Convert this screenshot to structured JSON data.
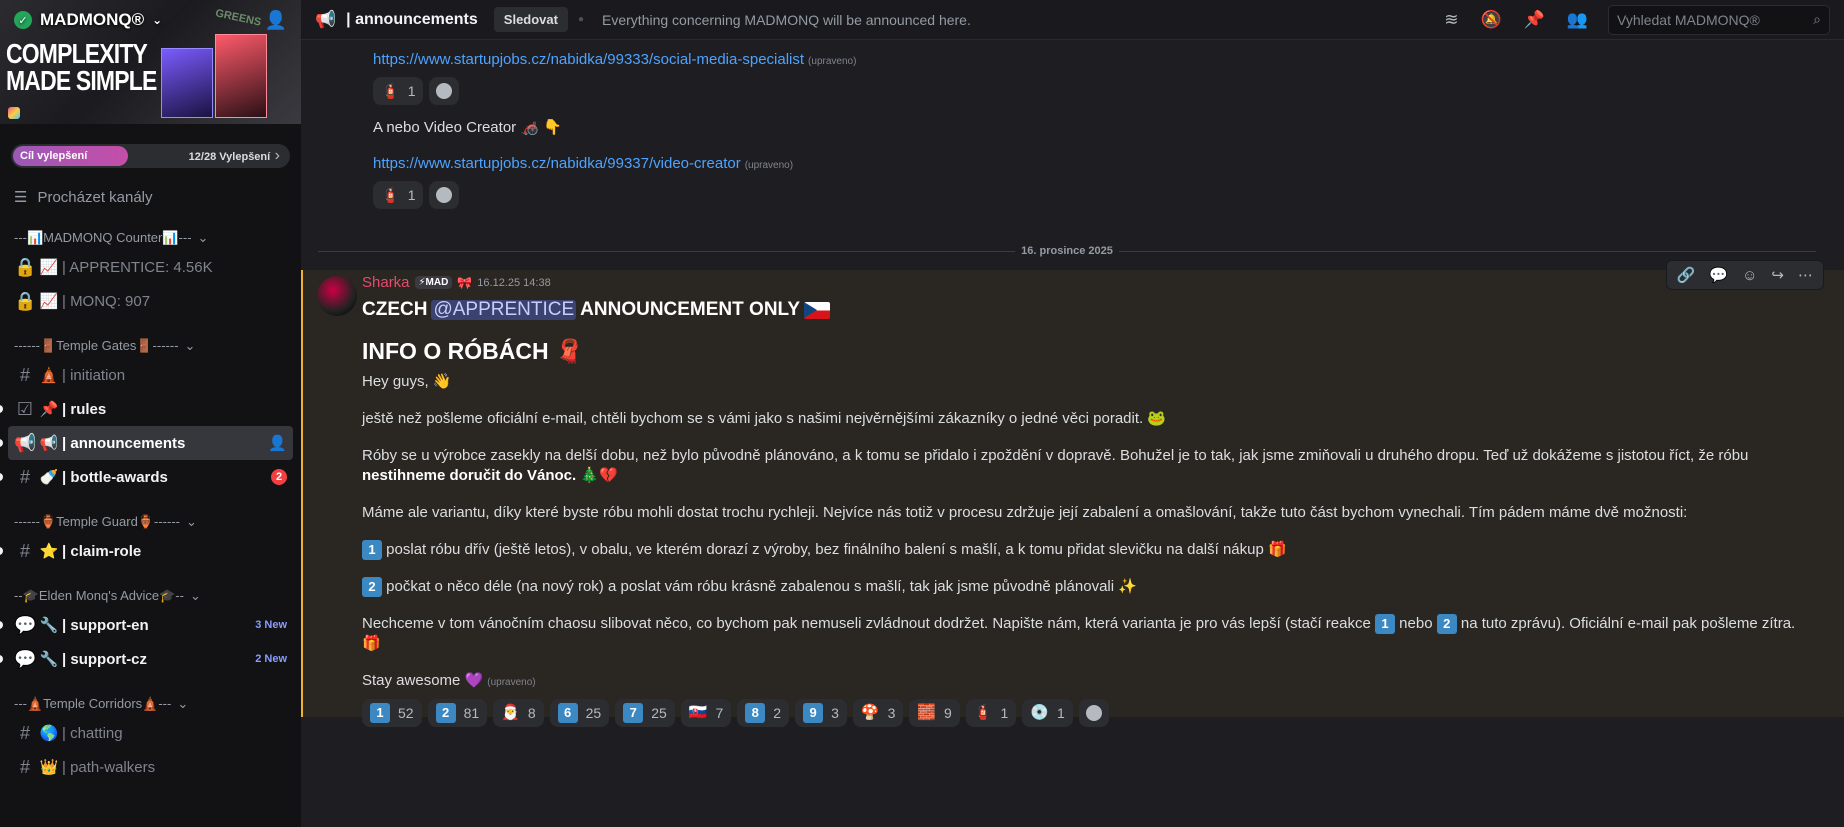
{
  "server": {
    "name": "MADMONQ®",
    "banner_headline_1": "COMPLEXITY",
    "banner_headline_2": "MADE SIMPLE",
    "banner_tag": "GREENS"
  },
  "boost": {
    "label": "Cíl vylepšení",
    "count": "12/28 Vylepšení",
    "progress": 0.43
  },
  "browse_label": "Procházet kanály",
  "sidebar": {
    "categories": [
      "---📊MADMONQ Counter📊---",
      "------🚪Temple Gates🚪------",
      "------🏺Temple Guard🏺------",
      "--🎓Elden Monq's Advice🎓--",
      "---🛕Temple Corridors🛕---"
    ],
    "channels": [
      {
        "icon": "📈",
        "label": "|  APPRENTICE: 4.56K"
      },
      {
        "icon": "📈",
        "label": "|  MONQ: 907"
      },
      {
        "icon": "🛕",
        "label": "| initiation"
      },
      {
        "icon": "📌",
        "label": "| rules"
      },
      {
        "icon": "📢",
        "label": "| announcements"
      },
      {
        "icon": "🍼",
        "label": "| bottle-awards",
        "badge": "2"
      },
      {
        "icon": "⭐",
        "label": "| claim-role"
      },
      {
        "icon": "🔧",
        "label": "| support-en",
        "badge": "3 New"
      },
      {
        "icon": "🔧",
        "label": "| support-cz",
        "badge": "2 New"
      },
      {
        "icon": "🌎",
        "label": "| chatting"
      },
      {
        "icon": "👑",
        "label": "| path-walkers"
      }
    ]
  },
  "topbar": {
    "channel": "| announcements",
    "follow": "Sledovat",
    "topic": "Everything concerning MADMONQ will be announced here.",
    "search_placeholder": "Vyhledat MADMONQ®"
  },
  "previous": {
    "link1": "https://www.startupjobs.cz/nabidka/99333/social-media-specialist",
    "edited": "(upraveno)",
    "react1": "1",
    "text": "A nebo Video Creator 🦽 👇",
    "link2": "https://www.startupjobs.cz/nabidka/99337/video-creator",
    "react2": "1"
  },
  "date_divider": "16. prosince 2025",
  "message": {
    "author": "Sharka",
    "tag": "⚡MAD",
    "time": "16.12.25 14:38",
    "h1_a": "CZECH",
    "h1_mention": "@APPRENTICE",
    "h1_b": "ANNOUNCEMENT ONLY",
    "h2": "INFO O RÓBÁCH 🧣",
    "p1": "Hey guys, 👋",
    "p2": "ještě než pošleme oficiální e-mail, chtěli bychom se s vámi jako s našimi nejvěrnějšími zákazníky o jedné věci poradit. 🐸",
    "p3a": "Róby se u výrobce zasekly na delší dobu, než bylo původně plánováno, a k tomu se přidalo i zpoždění v dopravě. Bohužel je to tak, jak jsme zmiňovali u druhého dropu. Teď už dokážeme s jistotou říct, že róbu",
    "p3b": "nestihneme doručit do Vánoc.",
    "p3c": " 🎄💔",
    "p4": "Máme ale variantu, díky které byste róbu mohli dostat trochu rychleji. Nejvíce nás totiž v procesu zdržuje její zabalení a omašlování, takže tuto část bychom vynechali. Tím pádem máme dvě možnosti:",
    "opt1": "poslat róbu dřív (ještě letos), v obalu, ve kterém dorazí z výroby, bez finálního balení s mašlí, a k tomu přidat slevičku na další nákup 🎁",
    "opt2": "počkat o něco déle (na nový rok) a poslat vám róbu krásně zabalenou s mašlí, tak jak jsme původně plánovali ✨",
    "p5a": "Nechceme v tom vánočním chaosu slibovat něco, co bychom pak nemuseli zvládnout dodržet. Napište nám, která varianta je pro vás lepší (stačí reakce",
    "p5b": "nebo",
    "p5c": "na tuto zprávu). Oficiální e-mail pak pošleme zítra. 🎁",
    "p6": "Stay awesome 💜",
    "edited": "(upraveno)"
  },
  "reactions": [
    {
      "emoji": "1",
      "count": "52",
      "keycap": true
    },
    {
      "emoji": "2",
      "count": "81",
      "keycap": true
    },
    {
      "emoji": "🎅",
      "count": "8"
    },
    {
      "emoji": "6",
      "count": "25",
      "keycap": true
    },
    {
      "emoji": "7",
      "count": "25",
      "keycap": true
    },
    {
      "emoji": "🇸🇰",
      "count": "7"
    },
    {
      "emoji": "8",
      "count": "2",
      "keycap": true
    },
    {
      "emoji": "9",
      "count": "3",
      "keycap": true
    },
    {
      "emoji": "🍄",
      "count": "3"
    },
    {
      "emoji": "🧱",
      "count": "9"
    },
    {
      "emoji": "🧯",
      "count": "1"
    },
    {
      "emoji": "💿",
      "count": "1"
    }
  ],
  "colors": {
    "accent_link": "#4da3ff",
    "author": "#e44b6e",
    "highlight_bar": "#f0b232"
  }
}
